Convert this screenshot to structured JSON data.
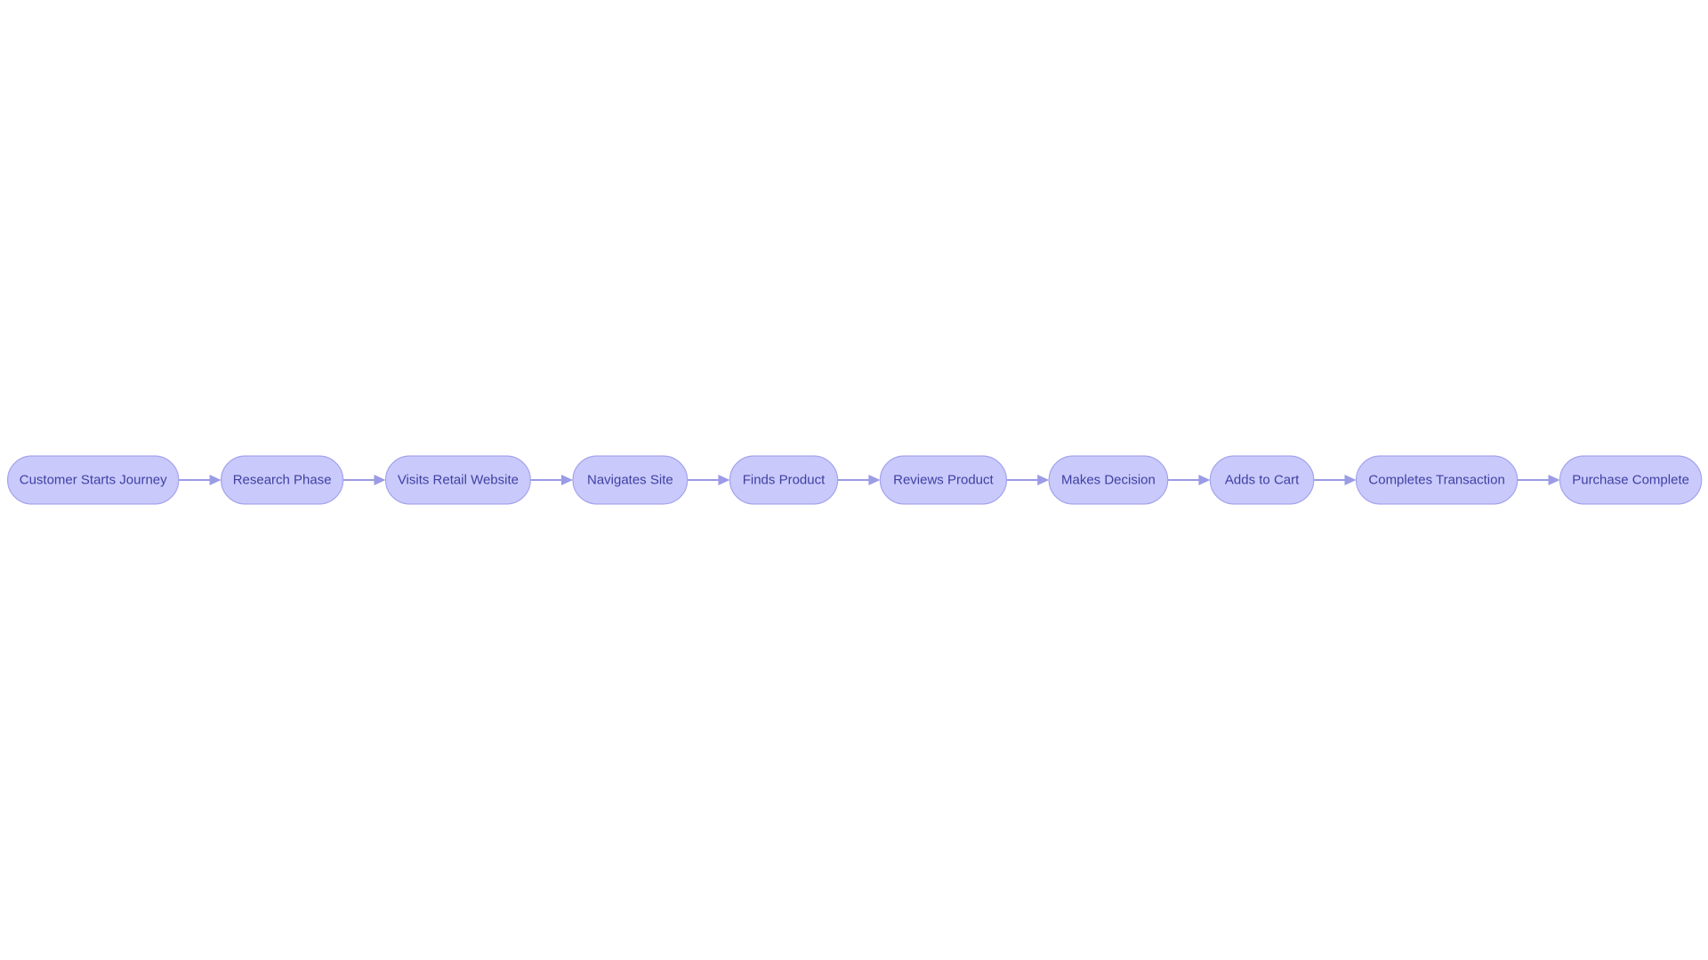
{
  "diagram": {
    "type": "flowchart",
    "direction": "left-to-right",
    "colors": {
      "node_fill": "#c9cafb",
      "node_stroke": "#a3a3ee",
      "text": "#3f3fa3",
      "edge": "#9b9be6"
    },
    "nodes": [
      {
        "id": "n1",
        "label": "Customer Starts Journey"
      },
      {
        "id": "n2",
        "label": "Research Phase"
      },
      {
        "id": "n3",
        "label": "Visits Retail Website"
      },
      {
        "id": "n4",
        "label": "Navigates Site"
      },
      {
        "id": "n5",
        "label": "Finds Product"
      },
      {
        "id": "n6",
        "label": "Reviews Product"
      },
      {
        "id": "n7",
        "label": "Makes Decision"
      },
      {
        "id": "n8",
        "label": "Adds to Cart"
      },
      {
        "id": "n9",
        "label": "Completes Transaction"
      },
      {
        "id": "n10",
        "label": "Purchase Complete"
      }
    ],
    "edges": [
      {
        "from": "n1",
        "to": "n2"
      },
      {
        "from": "n2",
        "to": "n3"
      },
      {
        "from": "n3",
        "to": "n4"
      },
      {
        "from": "n4",
        "to": "n5"
      },
      {
        "from": "n5",
        "to": "n6"
      },
      {
        "from": "n6",
        "to": "n7"
      },
      {
        "from": "n7",
        "to": "n8"
      },
      {
        "from": "n8",
        "to": "n9"
      },
      {
        "from": "n9",
        "to": "n10"
      }
    ]
  }
}
